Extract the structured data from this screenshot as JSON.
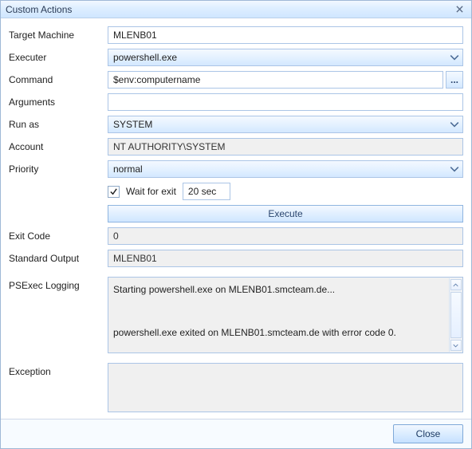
{
  "window": {
    "title": "Custom Actions",
    "close_label": "Close"
  },
  "labels": {
    "target_machine": "Target Machine",
    "executer": "Executer",
    "command": "Command",
    "arguments": "Arguments",
    "run_as": "Run as",
    "account": "Account",
    "priority": "Priority",
    "wait_for_exit": "Wait for exit",
    "execute": "Execute",
    "exit_code": "Exit Code",
    "std_output": "Standard Output",
    "psexec_logging": "PSExec Logging",
    "exception": "Exception",
    "ellipsis": "..."
  },
  "values": {
    "target_machine": "MLENB01",
    "executer": "powershell.exe",
    "command": "$env:computername",
    "arguments": "",
    "run_as": "SYSTEM",
    "account": "NT AUTHORITY\\SYSTEM",
    "priority": "normal",
    "wait_checked": true,
    "wait_value": "20 sec",
    "exit_code": "0",
    "std_output": "MLENB01",
    "psexec_log": "Starting powershell.exe on MLENB01.smcteam.de...\n\n\npowershell.exe exited on MLENB01.smcteam.de with error code 0.",
    "exception": ""
  }
}
